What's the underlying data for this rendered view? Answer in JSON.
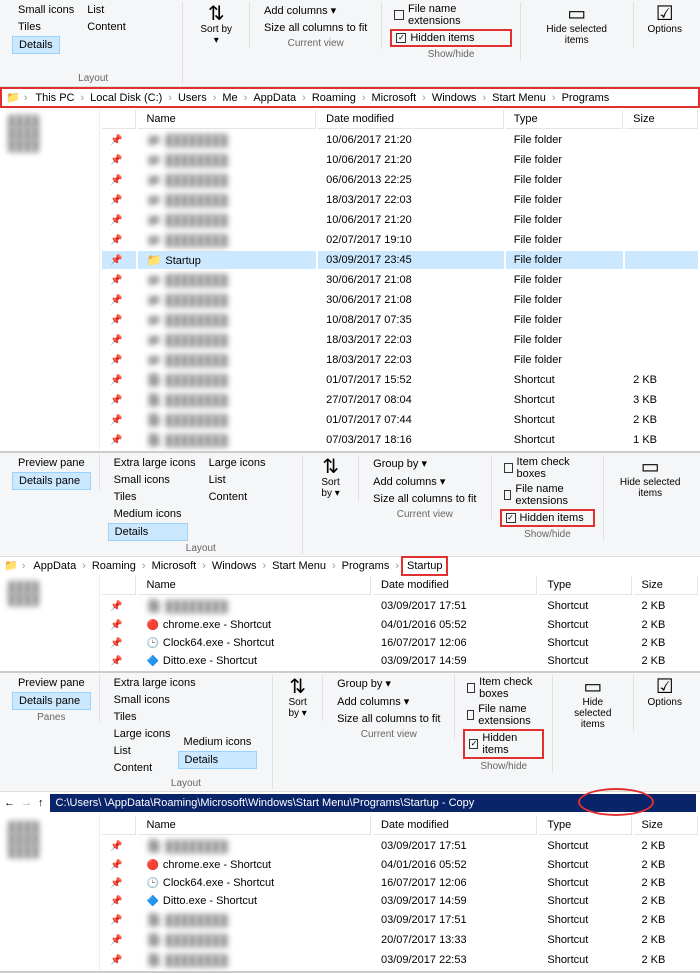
{
  "ribbon": {
    "panes": {
      "preview": "Preview pane",
      "details": "Details pane",
      "group_label": "Panes"
    },
    "layout": {
      "extra_large": "Extra large icons",
      "large": "Large icons",
      "medium": "Medium icons",
      "small": "Small icons",
      "list": "List",
      "details": "Details",
      "tiles": "Tiles",
      "content": "Content",
      "group_label": "Layout",
      "sort_by": "Sort by ▾"
    },
    "currentview": {
      "group_by": "Group by ▾",
      "add_columns": "Add columns ▾",
      "size_all": "Size all columns to fit",
      "group_label": "Current view"
    },
    "showhide": {
      "item_check": "Item check boxes",
      "file_ext": "File name extensions",
      "hidden": "Hidden items",
      "hide_selected": "Hide selected items",
      "options": "Options",
      "group_label": "Show/hide"
    }
  },
  "crumbs1": [
    "This PC",
    "Local Disk (C:)",
    "Users",
    "Me",
    "AppData",
    "Roaming",
    "Microsoft",
    "Windows",
    "Start Menu",
    "Programs"
  ],
  "crumbs2": [
    "AppData",
    "Roaming",
    "Microsoft",
    "Windows",
    "Start Menu",
    "Programs",
    "Startup"
  ],
  "addr3": "C:\\Users\\    \\AppData\\Roaming\\Microsoft\\Windows\\Start Menu\\Programs\\Startup - Copy",
  "cols": {
    "name": "Name",
    "date": "Date modified",
    "type": "Type",
    "size": "Size"
  },
  "rows1": [
    {
      "n": "",
      "d": "10/06/2017 21:20",
      "t": "File folder",
      "s": "",
      "ic": "folder",
      "blur": true
    },
    {
      "n": "",
      "d": "10/06/2017 21:20",
      "t": "File folder",
      "s": "",
      "ic": "folder",
      "blur": true
    },
    {
      "n": "",
      "d": "06/06/2013 22:25",
      "t": "File folder",
      "s": "",
      "ic": "folder",
      "blur": true
    },
    {
      "n": "",
      "d": "18/03/2017 22:03",
      "t": "File folder",
      "s": "",
      "ic": "folder",
      "blur": true
    },
    {
      "n": "",
      "d": "10/06/2017 21:20",
      "t": "File folder",
      "s": "",
      "ic": "folder",
      "blur": true
    },
    {
      "n": "",
      "d": "02/07/2017 19:10",
      "t": "File folder",
      "s": "",
      "ic": "folder",
      "blur": true
    },
    {
      "n": "Startup",
      "d": "03/09/2017 23:45",
      "t": "File folder",
      "s": "",
      "ic": "folder",
      "sel": true
    },
    {
      "n": "",
      "d": "30/06/2017 21:08",
      "t": "File folder",
      "s": "",
      "ic": "folder",
      "blur": true
    },
    {
      "n": "",
      "d": "30/06/2017 21:08",
      "t": "File folder",
      "s": "",
      "ic": "folder",
      "blur": true
    },
    {
      "n": "",
      "d": "10/08/2017 07:35",
      "t": "File folder",
      "s": "",
      "ic": "folder",
      "blur": true
    },
    {
      "n": "",
      "d": "18/03/2017 22:03",
      "t": "File folder",
      "s": "",
      "ic": "folder",
      "blur": true
    },
    {
      "n": "",
      "d": "18/03/2017 22:03",
      "t": "File folder",
      "s": "",
      "ic": "folder",
      "blur": true
    },
    {
      "n": "",
      "d": "01/07/2017 15:52",
      "t": "Shortcut",
      "s": "2 KB",
      "ic": "shortcut",
      "blur": true
    },
    {
      "n": "",
      "d": "27/07/2017 08:04",
      "t": "Shortcut",
      "s": "3 KB",
      "ic": "shortcut",
      "blur": true
    },
    {
      "n": "",
      "d": "01/07/2017 07:44",
      "t": "Shortcut",
      "s": "2 KB",
      "ic": "shortcut",
      "blur": true
    },
    {
      "n": "",
      "d": "07/03/2017 18:16",
      "t": "Shortcut",
      "s": "1 KB",
      "ic": "shortcut",
      "blur": true
    }
  ],
  "rows2": [
    {
      "n": "",
      "d": "03/09/2017 17:51",
      "t": "Shortcut",
      "s": "2 KB",
      "ic": "shortcut",
      "blur": true
    },
    {
      "n": "chrome.exe - Shortcut",
      "d": "04/01/2016 05:52",
      "t": "Shortcut",
      "s": "2 KB",
      "ic": "chrome"
    },
    {
      "n": "Clock64.exe - Shortcut",
      "d": "16/07/2017 12:06",
      "t": "Shortcut",
      "s": "2 KB",
      "ic": "clock"
    },
    {
      "n": "Ditto.exe - Shortcut",
      "d": "03/09/2017 14:59",
      "t": "Shortcut",
      "s": "2 KB",
      "ic": "ditto"
    }
  ],
  "rows3": [
    {
      "n": "",
      "d": "03/09/2017 17:51",
      "t": "Shortcut",
      "s": "2 KB",
      "ic": "shortcut",
      "blur": true
    },
    {
      "n": "chrome.exe - Shortcut",
      "d": "04/01/2016 05:52",
      "t": "Shortcut",
      "s": "2 KB",
      "ic": "chrome"
    },
    {
      "n": "Clock64.exe - Shortcut",
      "d": "16/07/2017 12:06",
      "t": "Shortcut",
      "s": "2 KB",
      "ic": "clock"
    },
    {
      "n": "Ditto.exe - Shortcut",
      "d": "03/09/2017 14:59",
      "t": "Shortcut",
      "s": "2 KB",
      "ic": "ditto"
    },
    {
      "n": "",
      "d": "03/09/2017 17:51",
      "t": "Shortcut",
      "s": "2 KB",
      "ic": "shortcut",
      "blur": true
    },
    {
      "n": "",
      "d": "20/07/2017 13:33",
      "t": "Shortcut",
      "s": "2 KB",
      "ic": "shortcut",
      "blur": true
    },
    {
      "n": "",
      "d": "03/09/2017 22:53",
      "t": "Shortcut",
      "s": "2 KB",
      "ic": "shortcut",
      "blur": true
    }
  ]
}
